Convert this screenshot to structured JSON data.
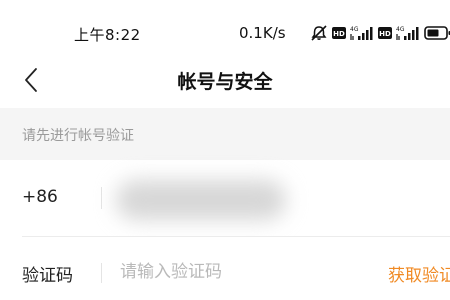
{
  "status_bar": {
    "time": "上午8:22",
    "network_speed": "0.1K/s",
    "icons": [
      "mute-notification-icon",
      "hd-icon",
      "signal-4g-icon",
      "hd-icon",
      "signal-4g-icon",
      "battery-icon"
    ],
    "sim1_label": "4G",
    "sim2_label": "4G",
    "hd_label": "HD"
  },
  "header": {
    "title": "帐号与安全",
    "back_icon": "chevron-left-icon"
  },
  "hint": {
    "text": "请先进行帐号验证"
  },
  "phone": {
    "country_code": "+86",
    "number": ""
  },
  "verification": {
    "label": "验证码",
    "placeholder": "请输入验证码",
    "value": "",
    "get_code_label": "获取验证码"
  },
  "colors": {
    "accent": "#f08a24",
    "hint_background": "#f5f5f5",
    "hint_text": "#9a9a9a",
    "placeholder": "#b9b9b9"
  }
}
